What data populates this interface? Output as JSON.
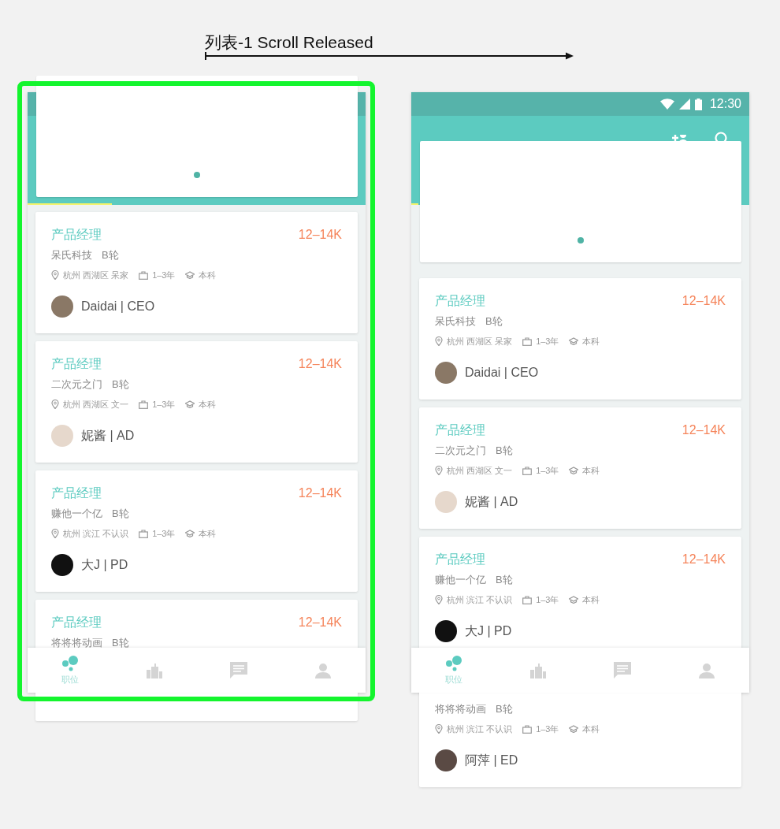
{
  "canvas": {
    "title": "列表-1 Scroll Released"
  },
  "frames": [
    {
      "kind": "released",
      "selected": true,
      "pull_indicator": {
        "level": 0.25
      },
      "banner_pages": [
        {
          "selected": true
        }
      ],
      "cards": [
        {
          "title": "产品经理",
          "salary": "12–14K",
          "company": "呆氏科技",
          "stage": "B轮",
          "location": "杭州 西湖区 呆家",
          "experience": "1–3年",
          "education": "本科",
          "person": {
            "name": "Daidai | CEO",
            "color": "#8a7866"
          }
        },
        {
          "title": "产品经理",
          "salary": "12–14K",
          "company": "二次元之门",
          "stage": "B轮",
          "location": "杭州 西湖区 文一",
          "experience": "1–3年",
          "education": "本科",
          "person": {
            "name": "妮酱 | AD",
            "color": "#e6d8cc"
          }
        },
        {
          "title": "产品经理",
          "salary": "12–14K",
          "company": "赚他一个亿",
          "stage": "B轮",
          "location": "杭州 滨江 不认识",
          "experience": "1–3年",
          "education": "本科",
          "person": {
            "name": "大J | PD",
            "color": "#111111"
          }
        },
        {
          "title": "产品经理",
          "salary": "12–14K",
          "company": "将将将动画",
          "stage": "B轮"
        }
      ],
      "tabs": [
        {
          "label": "职位",
          "selected": true
        },
        {
          "selected": false
        },
        {
          "selected": false
        },
        {
          "selected": false
        }
      ]
    },
    {
      "kind": "resting",
      "selected": false,
      "status_bar": {
        "time": "12:30"
      },
      "pull_indicator": {
        "level": 0.02
      },
      "banner_pages": [
        {
          "selected": true
        }
      ],
      "cards": [
        {
          "title": "产品经理",
          "salary": "12–14K",
          "company": "呆氏科技",
          "stage": "B轮",
          "location": "杭州 西湖区 呆家",
          "experience": "1–3年",
          "education": "本科",
          "person": {
            "name": "Daidai | CEO",
            "color": "#8a7866"
          }
        },
        {
          "title": "产品经理",
          "salary": "12–14K",
          "company": "二次元之门",
          "stage": "B轮",
          "location": "杭州 西湖区 文一",
          "experience": "1–3年",
          "education": "本科",
          "person": {
            "name": "妮酱 | AD",
            "color": "#e6d8cc"
          }
        },
        {
          "title": "产品经理",
          "salary": "12–14K",
          "company": "赚他一个亿",
          "stage": "B轮",
          "location": "杭州 滨江 不认识",
          "experience": "1–3年",
          "education": "本科",
          "person": {
            "name": "大J | PD",
            "color": "#111111"
          }
        },
        {
          "company": "将将将动画",
          "stage": "B轮",
          "location": "杭州 滨江 不认识",
          "experience": "1–3年",
          "education": "本科",
          "person": {
            "name": "阿萍 | ED",
            "color": "#5a4a44"
          }
        }
      ],
      "tabs": [
        {
          "label": "职位",
          "selected": true
        },
        {
          "selected": false
        },
        {
          "selected": false
        },
        {
          "selected": false
        }
      ]
    }
  ]
}
